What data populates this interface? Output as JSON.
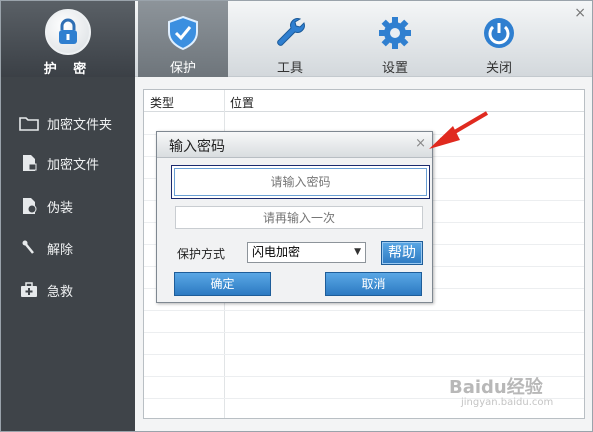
{
  "logo": {
    "label": "护 密"
  },
  "nav_tabs": [
    {
      "label": "保护",
      "icon": "shield-icon",
      "active": true
    },
    {
      "label": "工具",
      "icon": "wrench-icon",
      "active": false
    },
    {
      "label": "设置",
      "icon": "gear-icon",
      "active": false
    },
    {
      "label": "关闭",
      "icon": "power-icon",
      "active": false
    }
  ],
  "window": {
    "close_label": "×"
  },
  "sidebar": {
    "items": [
      {
        "label": "加密文件夹",
        "icon": "folder-icon"
      },
      {
        "label": "加密文件",
        "icon": "file-lock-icon"
      },
      {
        "label": "伪装",
        "icon": "disguise-icon"
      },
      {
        "label": "解除",
        "icon": "unlock-icon"
      },
      {
        "label": "急救",
        "icon": "first-aid-icon"
      }
    ]
  },
  "table": {
    "columns": [
      "类型",
      "位置"
    ]
  },
  "dialog": {
    "title": "输入密码",
    "close_label": "×",
    "password_placeholder": "请输入密码",
    "confirm_placeholder": "请再输入一次",
    "mode_label": "保护方式",
    "mode_value": "闪电加密",
    "help_label": "帮助",
    "ok_label": "确定",
    "cancel_label": "取消"
  },
  "watermark": {
    "text": "Baidu经验",
    "sub": "jingyan.baidu.com"
  },
  "colors": {
    "accent": "#2d7ac2",
    "sidebar": "#3f4449",
    "annotation_arrow": "#e02a1f"
  }
}
